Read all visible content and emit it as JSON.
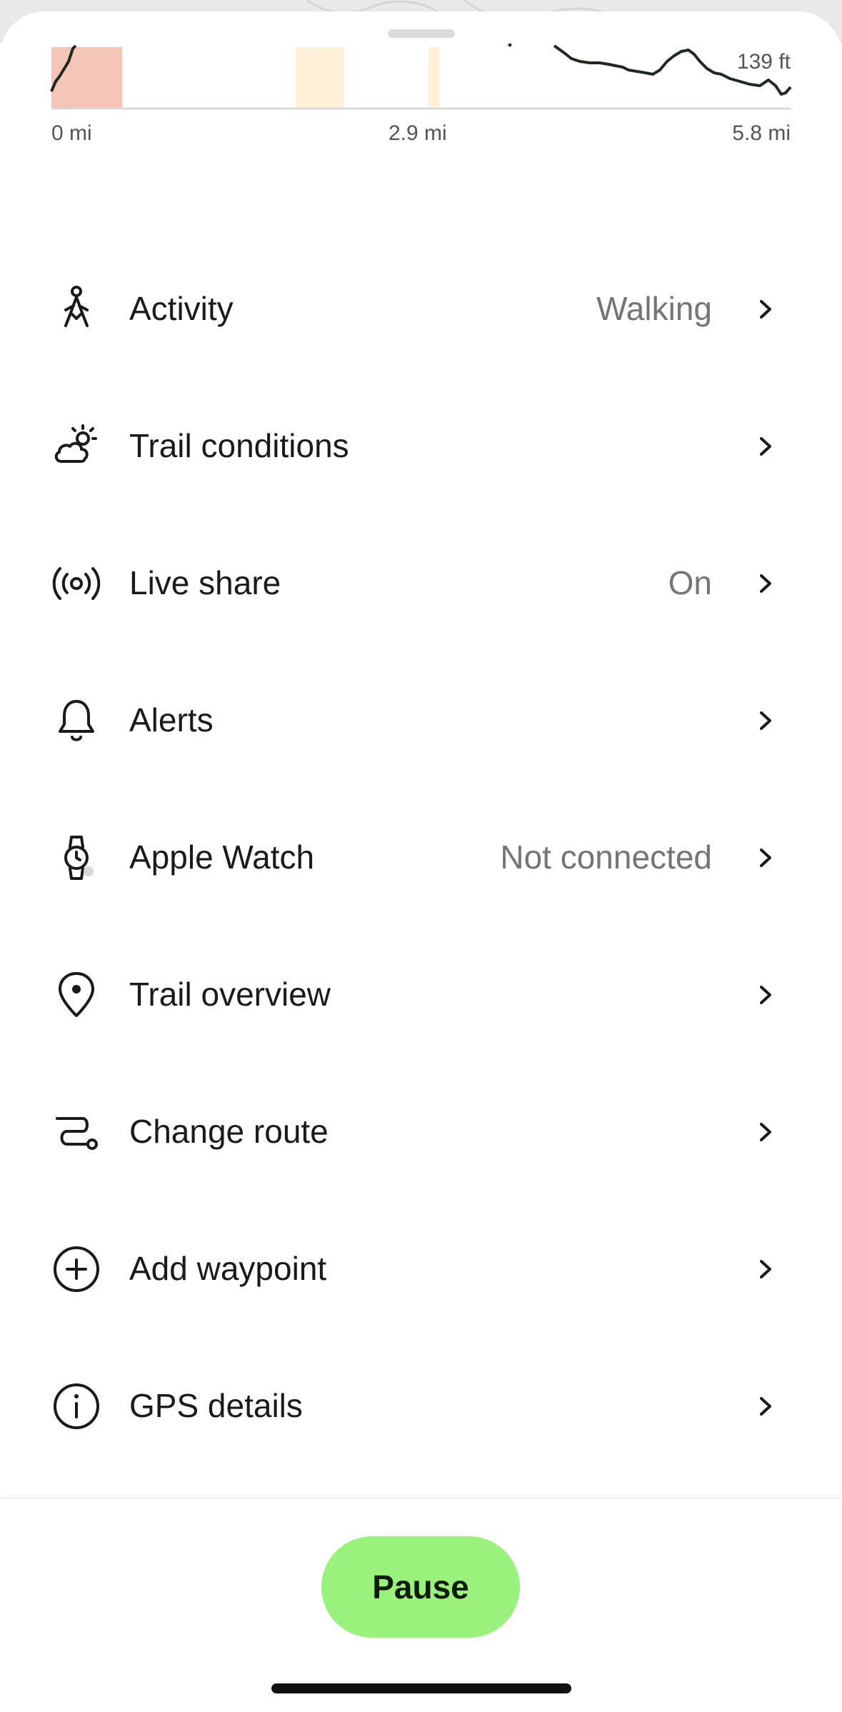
{
  "theme": {
    "accent": "#98f27b",
    "text_primary": "#1a1a1a",
    "text_secondary": "#757575",
    "elevation_line": "#1f2a1f",
    "grade_steep": "#f5c5b8",
    "grade_moderate": "#fdf0d6"
  },
  "elevation_chart": {
    "x_labels": [
      "0 mi",
      "2.9 mi",
      "5.8 mi"
    ],
    "max_label": "139 ft"
  },
  "menu": {
    "items": [
      {
        "label": "Activity",
        "value": "Walking",
        "icon": "walking-person-icon"
      },
      {
        "label": "Trail conditions",
        "value": "",
        "icon": "partly-cloudy-icon"
      },
      {
        "label": "Live share",
        "value": "On",
        "icon": "broadcast-icon"
      },
      {
        "label": "Alerts",
        "value": "",
        "icon": "bell-icon"
      },
      {
        "label": "Apple Watch",
        "value": "Not connected",
        "icon": "watch-icon"
      },
      {
        "label": "Trail overview",
        "value": "",
        "icon": "map-pin-icon"
      },
      {
        "label": "Change route",
        "value": "",
        "icon": "route-icon"
      },
      {
        "label": "Add waypoint",
        "value": "",
        "icon": "plus-circle-icon"
      },
      {
        "label": "GPS details",
        "value": "",
        "icon": "info-circle-icon"
      }
    ]
  },
  "controls": {
    "pause_label": "Pause"
  }
}
